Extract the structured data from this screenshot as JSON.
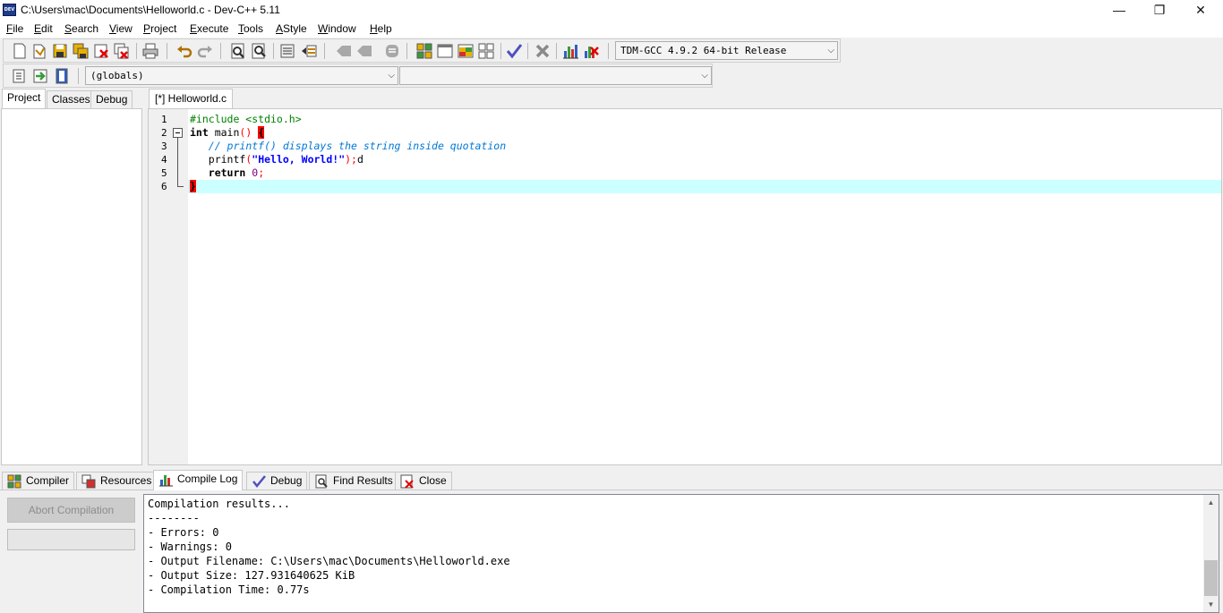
{
  "window": {
    "title": "C:\\Users\\mac\\Documents\\Helloworld.c - Dev-C++ 5.11",
    "app_icon_text": "DEV",
    "minimize": "—",
    "restore": "❐",
    "close": "✕"
  },
  "menu": [
    {
      "label": "File",
      "u": "F",
      "rest": "ile"
    },
    {
      "label": "Edit",
      "u": "E",
      "rest": "dit"
    },
    {
      "label": "Search",
      "u": "S",
      "rest": "earch"
    },
    {
      "label": "View",
      "u": "V",
      "rest": "iew"
    },
    {
      "label": "Project",
      "u": "P",
      "rest": "roject"
    },
    {
      "label": "Execute",
      "u": "E",
      "rest": "xecute"
    },
    {
      "label": "Tools",
      "u": "T",
      "rest": "ools"
    },
    {
      "label": "AStyle",
      "u": "A",
      "rest": "Style"
    },
    {
      "label": "Window",
      "u": "W",
      "rest": "indow"
    },
    {
      "label": "Help",
      "u": "H",
      "rest": "elp"
    }
  ],
  "toolbar": {
    "compiler_select": "TDM-GCC 4.9.2 64-bit Release",
    "class_select": "(globals)",
    "member_select": ""
  },
  "left_tabs": [
    "Project",
    "Classes",
    "Debug"
  ],
  "editor": {
    "tab_label": "[*] Helloworld.c",
    "line_numbers": [
      "1",
      "2",
      "3",
      "4",
      "5",
      "6"
    ],
    "code": {
      "l1": "#include <stdio.h>",
      "l2_kw": "int",
      "l2_rest": " main",
      "l2_paren": "()",
      "l2_brace": "{",
      "l3": "// printf() displays the string inside quotation",
      "l4_fn": "printf",
      "l4_open": "(",
      "l4_str": "\"Hello, World!\"",
      "l4_close": ");",
      "l4_tail": "d",
      "l5_kw": "return",
      "l5_num": "0",
      "l5_semi": ";",
      "l6_brace": "}"
    }
  },
  "bottom_tabs": [
    "Compiler",
    "Resources",
    "Compile Log",
    "Debug",
    "Find Results",
    "Close"
  ],
  "compile_panel": {
    "abort_label": "Abort Compilation",
    "log_lines": [
      "Compilation results...",
      "--------",
      "- Errors: 0",
      "- Warnings: 0",
      "- Output Filename: C:\\Users\\mac\\Documents\\Helloworld.exe",
      "- Output Size: 127.931640625 KiB",
      "- Compilation Time: 0.77s"
    ]
  }
}
